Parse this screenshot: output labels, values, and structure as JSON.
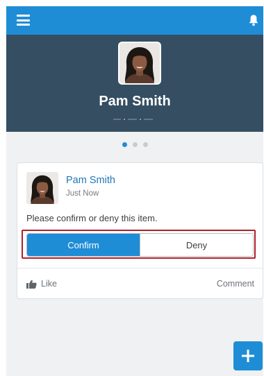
{
  "header": {
    "menu_icon": "hamburger-menu-icon",
    "notification_icon": "bell-icon"
  },
  "profile": {
    "name": "Pam Smith",
    "avatar_icon": "user-photo"
  },
  "pager": {
    "pages": 3,
    "active": 1
  },
  "feed_item": {
    "author": "Pam Smith",
    "time": "Just Now",
    "message": "Please confirm or deny this item.",
    "confirm_label": "Confirm",
    "deny_label": "Deny",
    "like_label": "Like",
    "comment_label": "Comment"
  },
  "fab": {
    "icon": "plus-icon"
  },
  "colors": {
    "accent": "#1f8dd6",
    "hero_bg": "#354e62",
    "highlight": "#b0202a"
  }
}
